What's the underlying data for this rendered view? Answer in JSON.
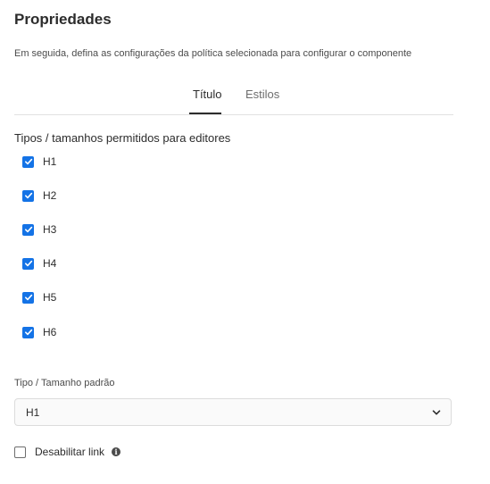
{
  "panel": {
    "title": "Propriedades",
    "description": "Em seguida, defina as configurações da política selecionada para configurar o componente"
  },
  "tabs": [
    {
      "label": "Título",
      "active": true
    },
    {
      "label": "Estilos",
      "active": false
    }
  ],
  "allowed_types": {
    "label": "Tipos / tamanhos permitidos para editores",
    "items": [
      {
        "label": "H1",
        "checked": true
      },
      {
        "label": "H2",
        "checked": true
      },
      {
        "label": "H3",
        "checked": true
      },
      {
        "label": "H4",
        "checked": true
      },
      {
        "label": "H5",
        "checked": true
      },
      {
        "label": "H6",
        "checked": true
      }
    ]
  },
  "default_type": {
    "label": "Tipo / Tamanho padrão",
    "value": "H1"
  },
  "disable_link": {
    "label": "Desabilitar link",
    "checked": false
  },
  "icons": {
    "checkbox": "checkmark-icon",
    "select": "chevron-down-icon",
    "info": "info-icon"
  },
  "colors": {
    "accent": "#1473e6",
    "text": "#2c2c2c",
    "divider": "#e1e1e1"
  }
}
